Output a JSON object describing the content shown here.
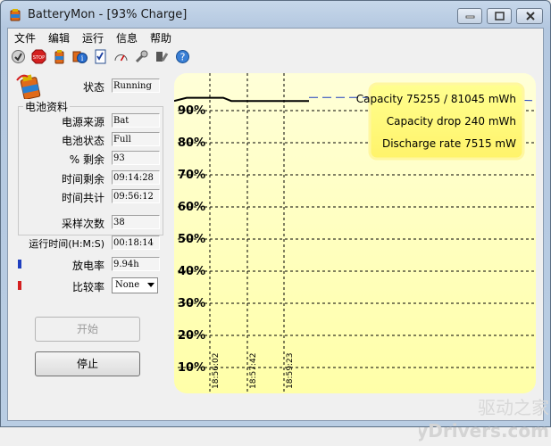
{
  "window": {
    "title": "BatteryMon - [93% Charge]"
  },
  "menu": [
    "文件",
    "编辑",
    "运行",
    "信息",
    "帮助"
  ],
  "toolbar_icons": [
    "check-icon",
    "stop-icon",
    "battery-icon",
    "info-icon",
    "checklist-icon",
    "gauge-icon",
    "tools-icon",
    "wrench-icon",
    "help-icon"
  ],
  "status": {
    "label": "状态",
    "value": "Running"
  },
  "battery_info": {
    "title": "电池资料",
    "rows": [
      {
        "label": "电源来源",
        "value": "Bat"
      },
      {
        "label": "电池状态",
        "value": "Full"
      },
      {
        "label": "% 剩余",
        "value": "93"
      },
      {
        "label": "时间剩余",
        "value": "09:14:28"
      },
      {
        "label": "时间共计",
        "value": "09:56:12"
      }
    ]
  },
  "samples": {
    "label": "采样次数",
    "value": "38"
  },
  "runtime": {
    "label": "运行时间(H:M:S)",
    "value": "00:18:14"
  },
  "discharge_rate": {
    "label": "放电率",
    "value": "9.94h",
    "color": "#1f3fbf"
  },
  "compare_rate": {
    "label": "比较率",
    "value": "None",
    "color": "#d42020"
  },
  "buttons": {
    "start": "开始",
    "stop": "停止"
  },
  "chart_data": {
    "type": "line",
    "y_ticks": [
      "90%",
      "80%",
      "70%",
      "60%",
      "50%",
      "40%",
      "30%",
      "20%",
      "10%"
    ],
    "x_ticks": [
      "18:56:02",
      "18:57:42",
      "18:59:23"
    ],
    "info_lines": [
      "Capacity 75255 / 81045 mWh",
      "Capacity drop 240 mWh",
      "Discharge rate 7515 mW"
    ],
    "series": [
      {
        "color": "#000000",
        "values": [
          93,
          94,
          94,
          93,
          93,
          93
        ]
      },
      {
        "color": "#1f3fbf",
        "values": [
          93,
          93,
          92.5,
          92
        ]
      }
    ],
    "background": "#ffffc0"
  },
  "watermark": {
    "text": "MyDrivers.com",
    "cn": "驱动之家"
  }
}
